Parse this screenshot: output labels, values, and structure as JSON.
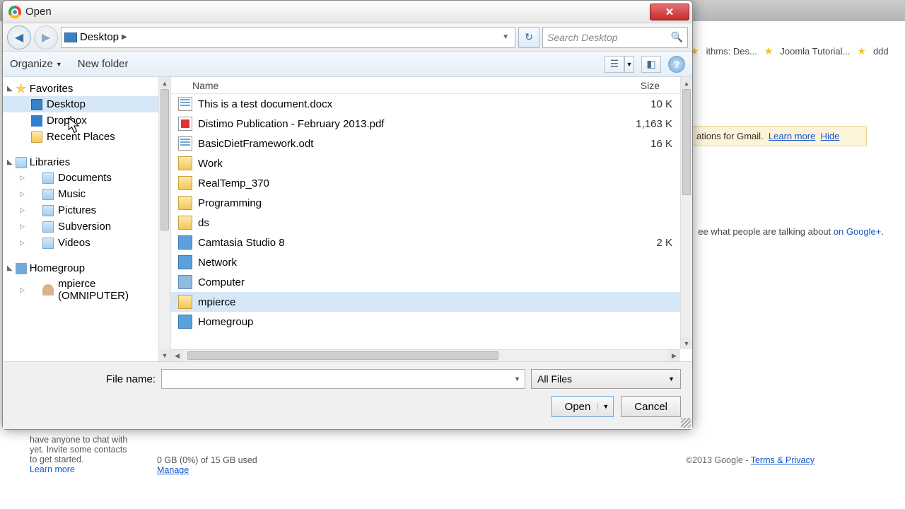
{
  "dialog": {
    "title": "Open",
    "path": {
      "location": "Desktop"
    },
    "search": {
      "placeholder": "Search Desktop"
    },
    "toolbar": {
      "organize": "Organize",
      "newFolder": "New folder"
    },
    "columns": {
      "name": "Name",
      "size": "Size"
    },
    "filename": {
      "label": "File name:",
      "value": ""
    },
    "filter": "All Files",
    "buttons": {
      "open": "Open",
      "cancel": "Cancel"
    }
  },
  "nav": {
    "favorites": {
      "label": "Favorites",
      "items": [
        {
          "label": "Desktop",
          "selected": true
        },
        {
          "label": "Dropbox"
        },
        {
          "label": "Recent Places"
        }
      ]
    },
    "libraries": {
      "label": "Libraries",
      "items": [
        {
          "label": "Documents"
        },
        {
          "label": "Music"
        },
        {
          "label": "Pictures"
        },
        {
          "label": "Subversion"
        },
        {
          "label": "Videos"
        }
      ]
    },
    "homegroup": {
      "label": "Homegroup",
      "items": [
        {
          "label": "mpierce (OMNIPUTER)"
        }
      ]
    }
  },
  "files": [
    {
      "name": "This is a test document.docx",
      "size": "10 K",
      "icon": "doc"
    },
    {
      "name": "Distimo Publication - February 2013.pdf",
      "size": "1,163 K",
      "icon": "pdf"
    },
    {
      "name": "BasicDietFramework.odt",
      "size": "16 K",
      "icon": "doc"
    },
    {
      "name": "Work",
      "size": "",
      "icon": "folder"
    },
    {
      "name": "RealTemp_370",
      "size": "",
      "icon": "folder"
    },
    {
      "name": "Programming",
      "size": "",
      "icon": "folder"
    },
    {
      "name": "ds",
      "size": "",
      "icon": "folder"
    },
    {
      "name": "Camtasia Studio 8",
      "size": "2 K",
      "icon": "net"
    },
    {
      "name": "Network",
      "size": "",
      "icon": "net"
    },
    {
      "name": "Computer",
      "size": "",
      "icon": "comp"
    },
    {
      "name": "mpierce",
      "size": "",
      "icon": "folder",
      "selected": true
    },
    {
      "name": "Homegroup",
      "size": "",
      "icon": "net"
    }
  ],
  "background": {
    "bookmarks": [
      {
        "label": "ithms: Des..."
      },
      {
        "label": "Joomla Tutorial..."
      },
      {
        "label": "ddd"
      }
    ],
    "banner": {
      "text": "ations for Gmail.",
      "learn": "Learn more",
      "hide": "Hide"
    },
    "gplus": {
      "text": "ee what people are talking about ",
      "link": "on Google+"
    },
    "chat": {
      "text": "have anyone to chat with yet. Invite some contacts to get started.",
      "link": "Learn more"
    },
    "storage": {
      "text": "0 GB (0%) of 15 GB used",
      "link": "Manage"
    },
    "footer": {
      "text": "©2013 Google - ",
      "link": "Terms & Privacy"
    }
  }
}
